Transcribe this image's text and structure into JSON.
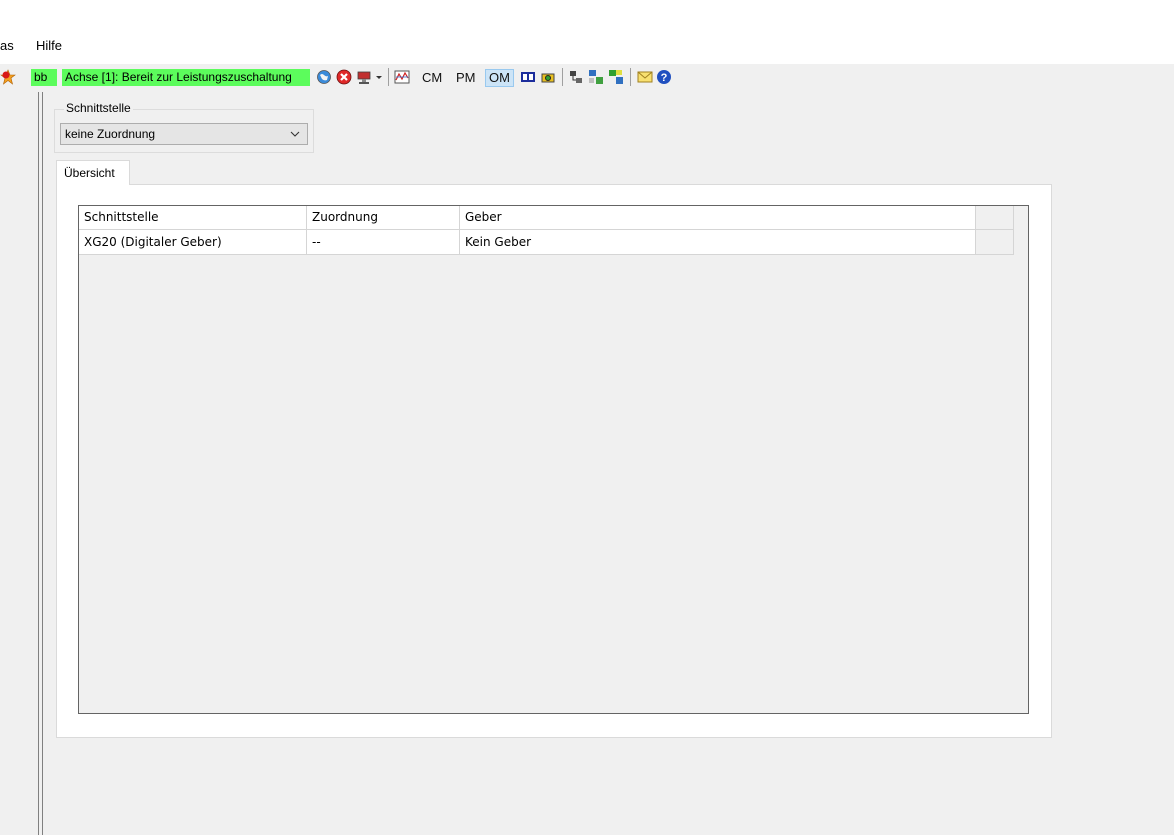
{
  "menu": {
    "items": [
      "as",
      "Hilfe"
    ]
  },
  "toolbar": {
    "device_label": "bb",
    "status_text": "Achse [1]:  Bereit zur Leistungszuschaltung",
    "buttons": [
      "CM",
      "PM",
      "OM"
    ],
    "active_button": "OM"
  },
  "interface": {
    "group_label": "Schnittstelle",
    "combo_value": "keine Zuordnung"
  },
  "tabs": [
    {
      "label": "Übersicht"
    }
  ],
  "grid": {
    "columns": [
      "Schnittstelle",
      "Zuordnung",
      "Geber"
    ],
    "rows": [
      [
        "XG20 (Digitaler Geber)",
        "--",
        "Kein Geber"
      ]
    ]
  },
  "colors": {
    "status_green": "#5cfc5c",
    "active_button": "#cce4f7"
  }
}
